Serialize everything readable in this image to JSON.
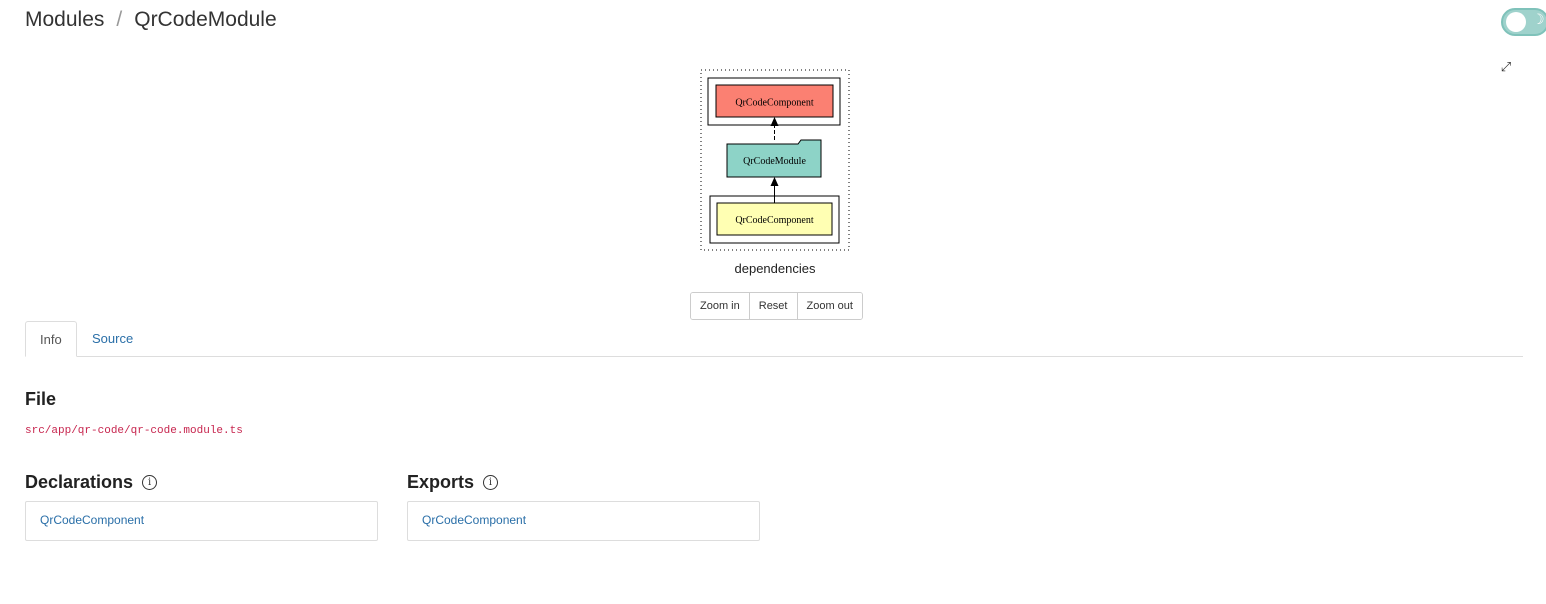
{
  "breadcrumb": {
    "items": [
      "Modules",
      "QrCodeModule"
    ],
    "separator": "/"
  },
  "toggle": {
    "icon": "moon-icon",
    "on": false
  },
  "fullscreen": {
    "icon": "expand-icon"
  },
  "graph": {
    "nodes": {
      "top_component": "QrCodeComponent",
      "module": "QrCodeModule",
      "bottom_component": "QrCodeComponent"
    },
    "caption": "dependencies",
    "colors": {
      "export_fill": "#fb8072",
      "module_fill": "#8dd3c7",
      "declaration_fill": "#ffffb3"
    }
  },
  "zoom": {
    "zoom_in": "Zoom in",
    "reset": "Reset",
    "zoom_out": "Zoom out"
  },
  "tabs": {
    "info": "Info",
    "source": "Source"
  },
  "file": {
    "title": "File",
    "path": "src/app/qr-code/qr-code.module.ts"
  },
  "declarations": {
    "title": "Declarations",
    "items": [
      "QrCodeComponent"
    ]
  },
  "exports": {
    "title": "Exports",
    "items": [
      "QrCodeComponent"
    ]
  }
}
